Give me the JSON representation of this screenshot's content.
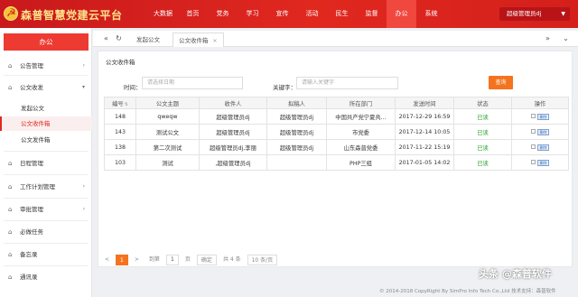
{
  "app": {
    "brand": "森普智慧党建云平台",
    "user": "超级管理员dj"
  },
  "nav": [
    "大数据",
    "首页",
    "党务",
    "学习",
    "宣传",
    "活动",
    "民生",
    "监督",
    "办公",
    "系统"
  ],
  "sidebar": {
    "title": "办公",
    "items": [
      {
        "label": "公告管理"
      },
      {
        "label": "公文收发"
      },
      {
        "label": "日程管理"
      },
      {
        "label": "工作计划管理"
      },
      {
        "label": "审批管理"
      },
      {
        "label": "必做任务"
      },
      {
        "label": "备忘录"
      },
      {
        "label": "通讯录"
      }
    ],
    "subitems": [
      "发起公文",
      "公文收件箱",
      "公文发件箱"
    ]
  },
  "tabs": [
    "发起公文",
    "公文收件箱"
  ],
  "panel": {
    "title": "公文收件箱",
    "time_label": "时间：",
    "date_placeholder": "请选择日期",
    "keyword_label": "关键字：",
    "keyword_placeholder": "请输入关键字",
    "query_button": "查询"
  },
  "table": {
    "headers": [
      "编号",
      "公文主题",
      "收件人",
      "拟稿人",
      "所在部门",
      "发送时间",
      "状态",
      "操作"
    ],
    "rows": [
      [
        "148",
        "qweqw",
        "超级管理员dj",
        "超级管理员dj",
        "中国共产党宁夏共...",
        "2017-12-29 16:59",
        "已读",
        "删除"
      ],
      [
        "143",
        "测试公文",
        "超级管理员dj",
        "超级管理员dj",
        "市党委",
        "2017-12-14 10:05",
        "已读",
        "删除"
      ],
      [
        "138",
        "第二次测试",
        "超级管理员dj,李丽",
        "超级管理员dj",
        "山东森普党委",
        "2017-11-22 15:19",
        "已读",
        "删除"
      ],
      [
        "103",
        "测试",
        ",超级管理员dj",
        "",
        "PHP三组",
        "2017-01-05 14:02",
        "已读",
        "删除"
      ]
    ]
  },
  "pager": {
    "first": "1",
    "prev": "<",
    "goto_label": "到第",
    "page_input": "1",
    "page_unit": "页",
    "confirm": "确定",
    "total": "共 4 条",
    "page_size": "10 条/页",
    "next": ">"
  },
  "footer": "© 2014-2018 CopyRight By SimPro Info Tech Co.,Ltd 技术支持：森普软件",
  "watermark": "头条 @森普软件"
}
